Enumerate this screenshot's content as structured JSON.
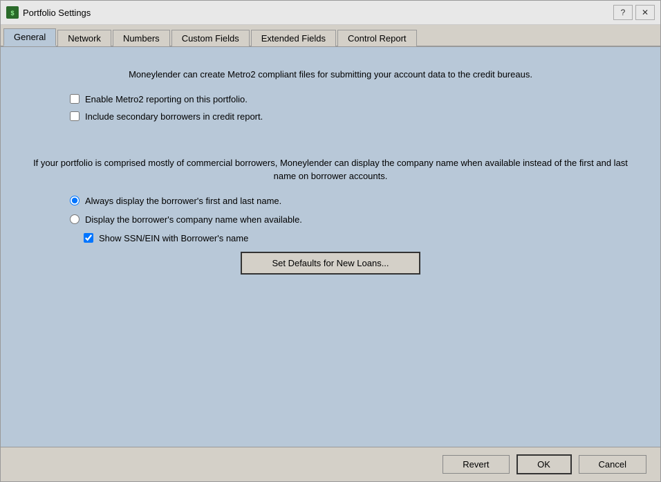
{
  "window": {
    "title": "Portfolio Settings",
    "icon": "$",
    "help_btn": "?",
    "close_btn": "✕"
  },
  "tabs": [
    {
      "label": "General",
      "active": true
    },
    {
      "label": "Network",
      "active": false
    },
    {
      "label": "Numbers",
      "active": false
    },
    {
      "label": "Custom Fields",
      "active": false
    },
    {
      "label": "Extended Fields",
      "active": false
    },
    {
      "label": "Control Report",
      "active": false
    }
  ],
  "content": {
    "section1_text": "Moneylender can create Metro2 compliant files for submitting your account data to the credit bureaus.",
    "checkbox1_label": "Enable Metro2 reporting on this portfolio.",
    "checkbox1_checked": false,
    "checkbox2_label": "Include secondary borrowers in credit report.",
    "checkbox2_checked": false,
    "section2_text": "If your portfolio is comprised mostly of commercial borrowers, Moneylender can display the company name when available instead of the first and last name on borrower accounts.",
    "radio1_label": "Always display the borrower's first and last name.",
    "radio1_checked": true,
    "radio2_label": "Display the borrower's company name when available.",
    "radio2_checked": false,
    "checkbox3_label": "Show SSN/EIN with Borrower's name",
    "checkbox3_checked": true,
    "defaults_btn_label": "Set Defaults for New Loans..."
  },
  "footer": {
    "revert_label": "Revert",
    "ok_label": "OK",
    "cancel_label": "Cancel"
  }
}
